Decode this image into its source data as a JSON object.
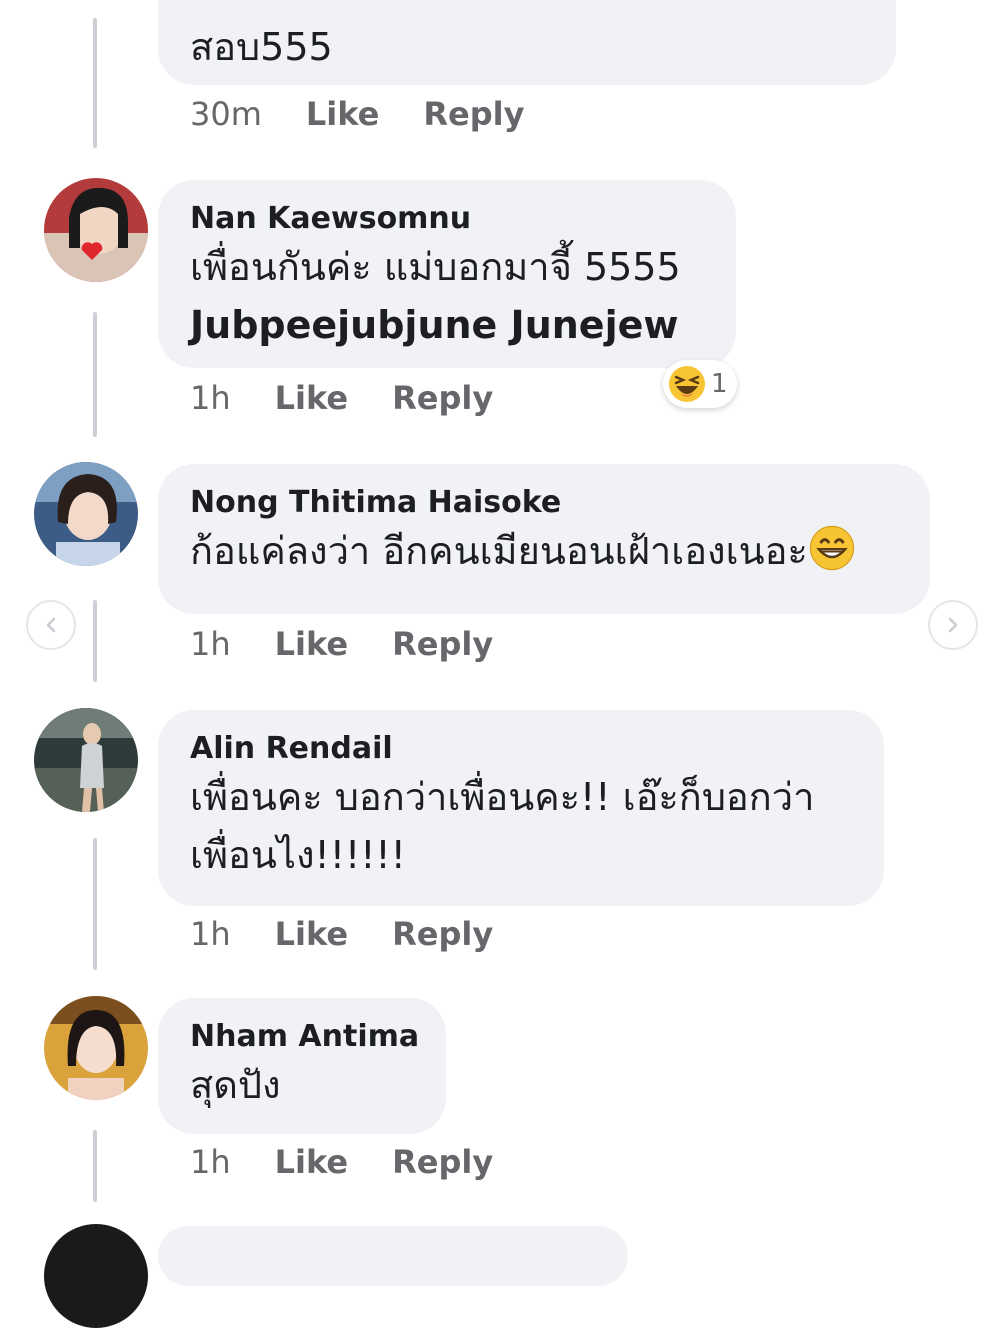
{
  "comments": [
    {
      "author": "",
      "text": "สอบ555",
      "time": "30m",
      "like": "Like",
      "reply": "Reply"
    },
    {
      "author": "Nan Kaewsomnu",
      "text": "เพื่อนกันค่ะ แม่บอกมาจี้ 5555",
      "mention": "Jubpeejubjune Junejew",
      "time": "1h",
      "like": "Like",
      "reply": "Reply",
      "reaction": {
        "icon": "laughing-emoji-icon",
        "count": "1"
      }
    },
    {
      "author": "Nong Thitima Haisoke",
      "text": "ก้อแค่ลงว่า อีกคนเมียนอนเฝ้าเองเนอะ",
      "emoji": "grinning-emoji-icon",
      "time": "1h",
      "like": "Like",
      "reply": "Reply"
    },
    {
      "author": "Alin Rendail",
      "text_line1": "เพื่อนคะ บอกว่าเพื่อนคะ!!  เอ๊ะก็บอกว่า",
      "text_line2": "เพื่อนไง!!!!!!",
      "time": "1h",
      "like": "Like",
      "reply": "Reply"
    },
    {
      "author": "Nham Antima",
      "text": "สุดปัง",
      "time": "1h",
      "like": "Like",
      "reply": "Reply"
    }
  ],
  "navigation": {
    "prev_icon": "chevron-left-icon",
    "next_icon": "chevron-right-icon"
  },
  "colors": {
    "bubble": "#f0f2f5",
    "meta": "#65676b",
    "thread_line": "#ccd0d5"
  }
}
